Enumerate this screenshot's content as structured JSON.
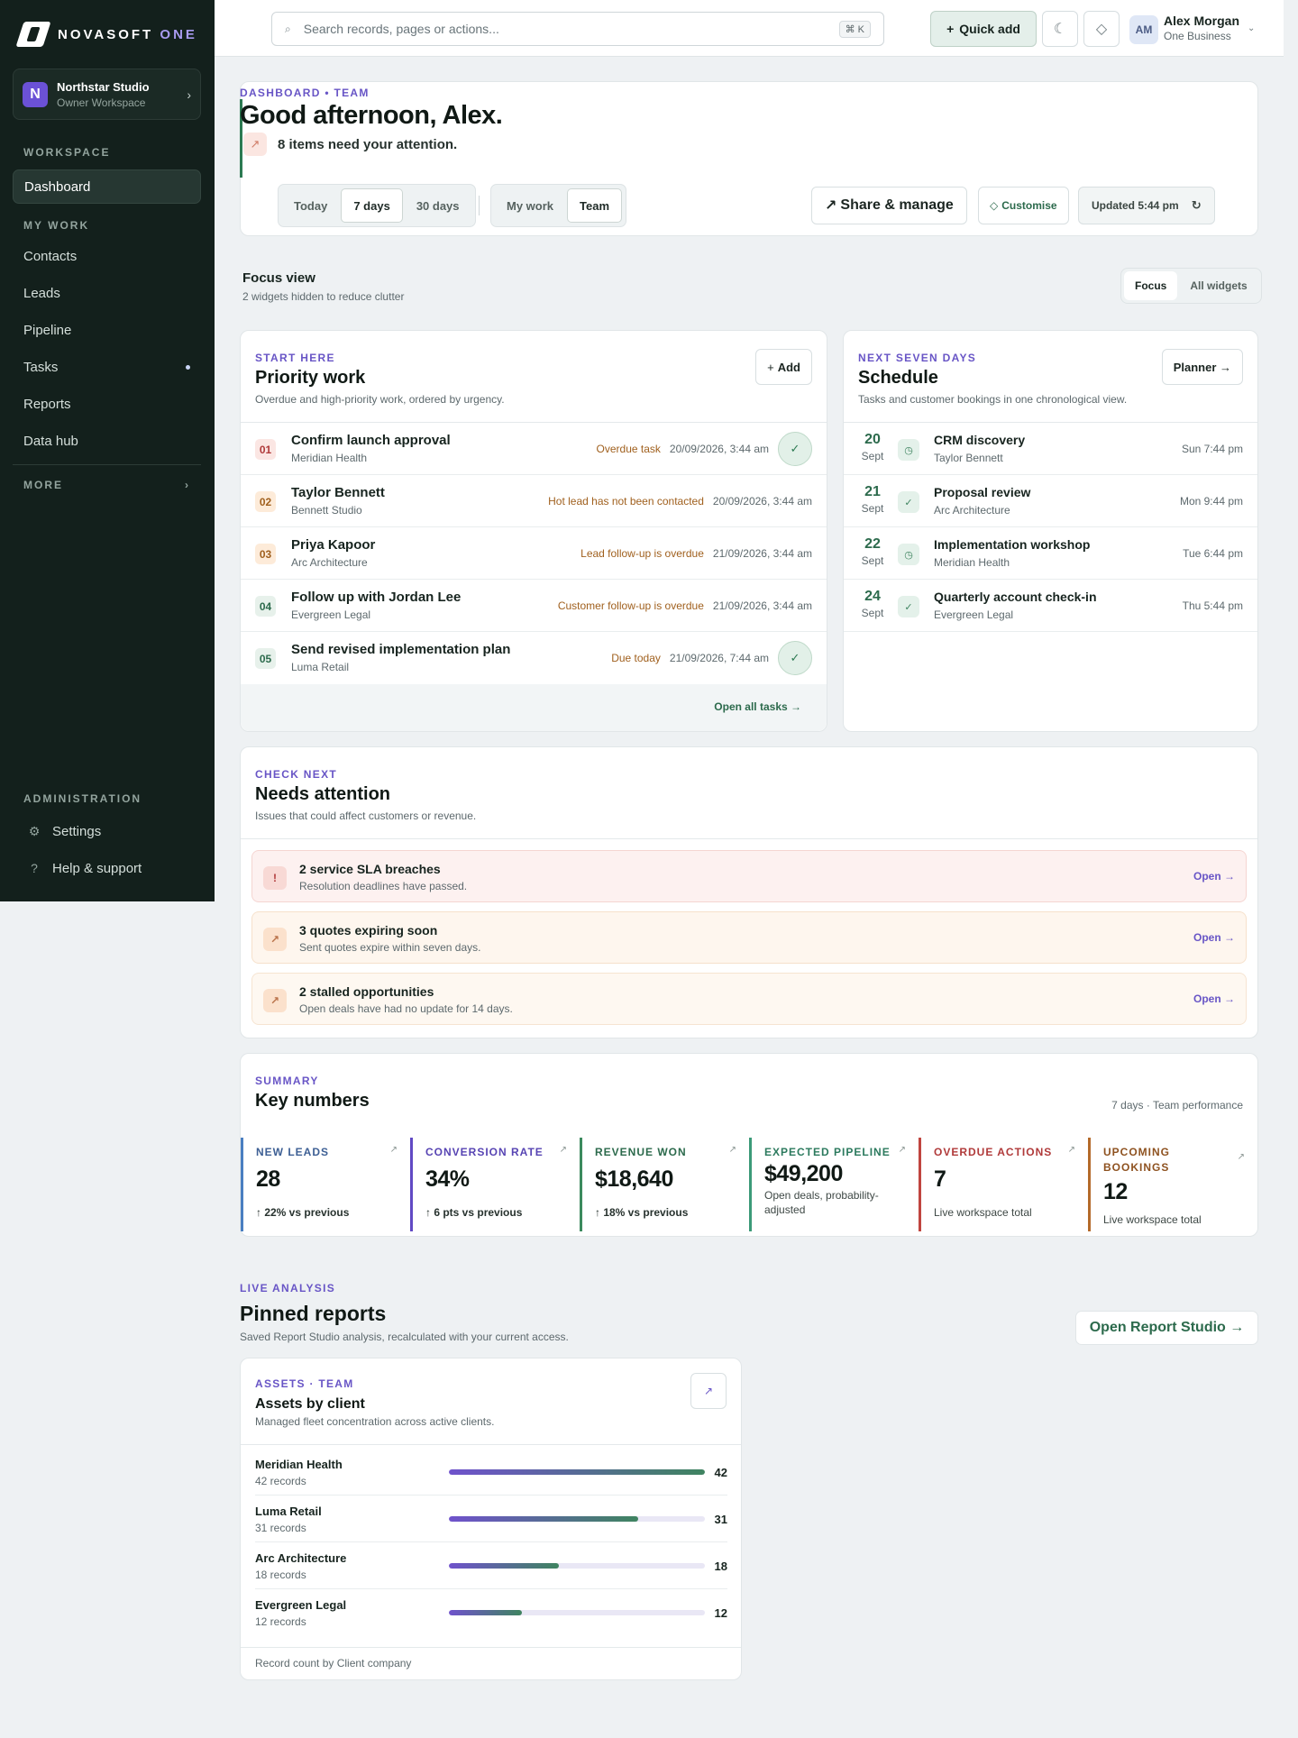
{
  "brand": {
    "name": "NOVASOFT",
    "suffix": "ONE"
  },
  "workspace": {
    "initial": "N",
    "name": "Northstar Studio",
    "role": "Owner Workspace"
  },
  "sidebar": {
    "workspace_heading": "WORKSPACE",
    "dashboard": "Dashboard",
    "mywork_heading": "MY WORK",
    "items": [
      "Contacts",
      "Leads",
      "Pipeline",
      "Tasks",
      "Reports",
      "Data hub"
    ],
    "more": "MORE",
    "admin_heading": "ADMINISTRATION",
    "settings": "Settings",
    "help": "Help & support"
  },
  "topbar": {
    "search_placeholder": "Search records, pages or actions...",
    "shortcut": "⌘ K",
    "quick_add": "Quick add",
    "user_initials": "AM",
    "user_name": "Alex Morgan",
    "user_org": "One Business"
  },
  "hero": {
    "eyebrow": "DASHBOARD • TEAM",
    "title": "Good afternoon, Alex.",
    "subtitle": "8 items need your attention.",
    "ranges": [
      "Today",
      "7 days",
      "30 days"
    ],
    "scopes": [
      "My work",
      "Team"
    ],
    "share": "Share & manage",
    "customise": "Customise",
    "updated": "Updated 5:44 pm"
  },
  "focus": {
    "title": "Focus view",
    "subtitle": "2 widgets hidden to reduce clutter",
    "options": [
      "Focus",
      "All widgets"
    ]
  },
  "priority": {
    "eyebrow": "START HERE",
    "title": "Priority work",
    "subtitle": "Overdue and high-priority work, ordered by urgency.",
    "add": "Add",
    "footer": "Open all tasks →",
    "rows": [
      {
        "num": "01",
        "name": "Confirm launch approval",
        "org": "Meridian Health",
        "tag": "Overdue task",
        "date": "20/09/2026, 3:44 am"
      },
      {
        "num": "02",
        "name": "Taylor Bennett",
        "org": "Bennett Studio",
        "tag": "Hot lead has not been contacted",
        "date": "20/09/2026, 3:44 am"
      },
      {
        "num": "03",
        "name": "Priya Kapoor",
        "org": "Arc Architecture",
        "tag": "Lead follow-up is overdue",
        "date": "21/09/2026, 3:44 am"
      },
      {
        "num": "04",
        "name": "Follow up with Jordan Lee",
        "org": "Evergreen Legal",
        "tag": "Customer follow-up is overdue",
        "date": "21/09/2026, 3:44 am"
      },
      {
        "num": "05",
        "name": "Send revised implementation plan",
        "org": "Luma Retail",
        "tag": "Due today",
        "date": "21/09/2026, 7:44 am"
      }
    ]
  },
  "schedule": {
    "eyebrow": "NEXT SEVEN DAYS",
    "title": "Schedule",
    "subtitle": "Tasks and customer bookings in one chronological view.",
    "planner": "Planner →",
    "rows": [
      {
        "day": "20",
        "month": "Sept",
        "name": "CRM discovery",
        "org": "Taylor Bennett",
        "time": "Sun 7:44 pm"
      },
      {
        "day": "21",
        "month": "Sept",
        "name": "Proposal review",
        "org": "Arc Architecture",
        "time": "Mon 9:44 pm"
      },
      {
        "day": "22",
        "month": "Sept",
        "name": "Implementation workshop",
        "org": "Meridian Health",
        "time": "Tue 6:44 pm"
      },
      {
        "day": "24",
        "month": "Sept",
        "name": "Quarterly account check-in",
        "org": "Evergreen Legal",
        "time": "Thu 5:44 pm"
      }
    ]
  },
  "attention": {
    "eyebrow": "CHECK NEXT",
    "title": "Needs attention",
    "subtitle": "Issues that could affect customers or revenue.",
    "open": "Open →",
    "rows": [
      {
        "name": "2 service SLA breaches",
        "desc": "Resolution deadlines have passed."
      },
      {
        "name": "3 quotes expiring soon",
        "desc": "Sent quotes expire within seven days."
      },
      {
        "name": "2 stalled opportunities",
        "desc": "Open deals have had no update for 14 days."
      }
    ]
  },
  "key": {
    "eyebrow": "SUMMARY",
    "title": "Key numbers",
    "meta": "7 days · Team performance",
    "tiles": [
      {
        "label": "NEW LEADS",
        "value": "28",
        "note": "↑ 22% vs previous"
      },
      {
        "label": "CONVERSION RATE",
        "value": "34%",
        "note": "↑ 6 pts vs previous"
      },
      {
        "label": "REVENUE WON",
        "value": "$18,640",
        "note": "↑ 18% vs previous"
      },
      {
        "label": "EXPECTED PIPELINE",
        "value": "$49,200",
        "note": "Open deals, probability-adjusted"
      },
      {
        "label": "OVERDUE ACTIONS",
        "value": "7",
        "note": "Live workspace total"
      },
      {
        "label": "UPCOMING BOOKINGS",
        "value": "12",
        "note": "Live workspace total"
      }
    ]
  },
  "live": {
    "eyebrow": "LIVE ANALYSIS",
    "title": "Pinned reports",
    "subtitle": "Saved Report Studio analysis, recalculated with your current access.",
    "studio": "Open Report Studio →"
  },
  "report": {
    "eyebrow": "ASSETS · TEAM",
    "title": "Assets by client",
    "subtitle": "Managed fleet concentration across active clients.",
    "footer": "Record count by Client company",
    "max": 42,
    "rows": [
      {
        "name": "Meridian Health",
        "count": "42 records",
        "value": 42
      },
      {
        "name": "Luma Retail",
        "count": "31 records",
        "value": 31
      },
      {
        "name": "Arc Architecture",
        "count": "18 records",
        "value": 18
      },
      {
        "name": "Evergreen Legal",
        "count": "12 records",
        "value": 12
      }
    ]
  },
  "colors": {
    "accent": "#6855c6",
    "brand_green": "#2c6a4c",
    "warning": "#a0601e",
    "danger": "#b03a3a"
  }
}
